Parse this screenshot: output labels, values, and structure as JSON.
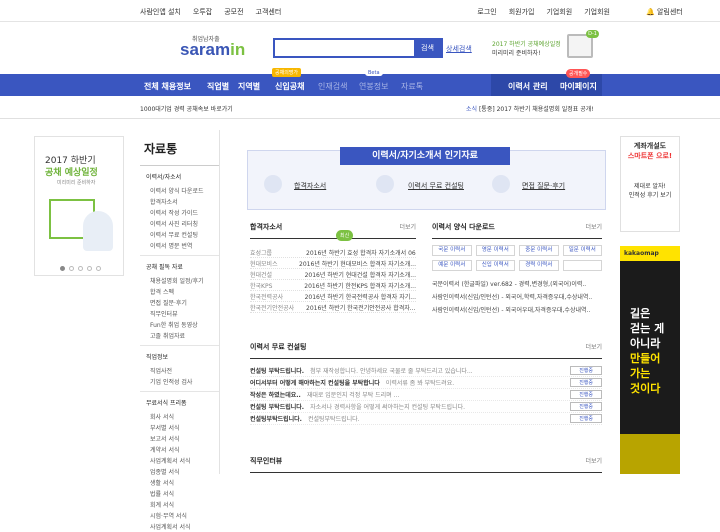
{
  "topbar": {
    "left": [
      "사람인앱 설치",
      "오투잡",
      "공모전",
      "고객센터"
    ],
    "right": [
      "로그인",
      "회원가입",
      "기업회원",
      "기업회원"
    ],
    "bell": "알림센터"
  },
  "logo": {
    "sub": "취업남자출",
    "main": "saram",
    "accent": "in"
  },
  "search": {
    "placeholder": "",
    "button": "검색",
    "detail": "상세검색"
  },
  "promo": {
    "line1": "2017 하반기 공채예상일정",
    "line2": "미리미리 준비하자!",
    "badge": "D-1"
  },
  "gnb": {
    "items": [
      "전체 채용정보",
      "직업별",
      "지역별",
      "신입공채",
      "인재검색",
      "연봉정보",
      "자료톡"
    ],
    "right": [
      "이력서 관리",
      "마이페이지"
    ],
    "tag_new": "공채의명가",
    "tag_beta": "Beta",
    "tag_event": "공개필수"
  },
  "ticker": {
    "left": "1000대기업 경력 공채속보 바로가기",
    "right_label": "소식",
    "right_text": "[통중] 2017 하반기 채용설명회 일정표 공개!"
  },
  "left_banner": {
    "t1": "2017 하반기",
    "t2": "공채 예상일정",
    "t3": "미리미리 준비하자"
  },
  "sidebar": {
    "title": "자료통",
    "sections": [
      {
        "label": "이력서/자소서",
        "items": [
          "이력서 양식 다운로드",
          "합격자소서",
          "이력서 작성 가이드",
          "이력서 사진 리터칭",
          "이력서 무료 컨설팅",
          "이력서 명문 번역"
        ]
      },
      {
        "label": "공채 필독 자료",
        "items": [
          "채용설명회 일정/후기",
          "합격 스펙",
          "면접 질문·후기",
          "직무인터뷰",
          "Fun한 취업 동영상",
          "고졸 취업자료"
        ]
      },
      {
        "label": "직업정보",
        "items": [
          "직업사전",
          "기업 인적성 검사"
        ]
      },
      {
        "label": "무료서식 프리폼",
        "items": [
          "회사 서식",
          "부서별 서식",
          "보고서 서식",
          "계약서 서식",
          "사업계획서 서식",
          "업종별 서식",
          "생활 서식",
          "법률 서식",
          "회계 서식",
          "시험·무역 서식",
          "사업계획서 서식"
        ]
      }
    ]
  },
  "mid": {
    "title": "이력서/자기소개서 인기자료",
    "links": [
      "합격자소서",
      "이력서 무료 컨설팅",
      "면접 질문·후기"
    ]
  },
  "pass": {
    "title": "합격자소서",
    "more": "더보기",
    "ribbon": "최신",
    "rows": [
      [
        "효성그룹",
        "2016년 하반기 효성 합격자 자기소개서 06"
      ],
      [
        "현대모비스",
        "2016년 하반기 현대모비스 합격자 자기소개..."
      ],
      [
        "현대건설",
        "2016년 하반기 현대건설 합격자 자기소개..."
      ],
      [
        "한국KPS",
        "2016년 하반기 한전KPS 합격자 자기소개..."
      ],
      [
        "한국전력공사",
        "2016년 하반기 한국전력공사 합격자 자기..."
      ],
      [
        "한국전기안전공사",
        "2016년 하반기 한국전기안전공사 합격자..."
      ]
    ]
  },
  "resume_dl": {
    "title": "이력서 양식 다운로드",
    "more": "더보기",
    "grid": [
      "국문 이력서",
      "영문 이력서",
      "중문 이력서",
      "일문 이력서",
      "예문 이력서",
      "신입 이력서",
      "경력 이력서",
      ""
    ],
    "lines": [
      "국문이력서 (한글파일) ver.682 - 경력,변경형,(외국어)이력..",
      "사람인이력서(신입/인턴선) - 외국어,학력,자격증우대,수상내역..",
      "사람인이력서(신입/인턴선) - 외국어우대,자격증우대,수상내역.."
    ]
  },
  "consult": {
    "title": "이력서 무료 컨설팅",
    "more": "더보기",
    "btn": "진행중",
    "rows": [
      [
        "컨설팅 부탁드립니다.",
        "첨부 재작성합니다. 안녕하세요 국물로 줄 부탁드리고 있습니다..."
      ],
      [
        "어디서부터 어떻게 해야하는지 컨설팅을 부탁합니다",
        "이력서류 좀 봐 부탁드려요."
      ],
      [
        "작성은 하였는데요..",
        "재대로 입문인지 걱정 부탁 드리며 ..."
      ],
      [
        "컨설팅 부탁드립니다.",
        "자소서나 경력사항을 어떻게 써야하는지 컨설팅 부탁드립니다."
      ],
      [
        "컨설팅부탁드립니다.",
        "컨설팅부탁드립니다."
      ]
    ]
  },
  "interview": {
    "title": "직무인터뷰",
    "more": "더보기"
  },
  "right_banner1": {
    "a": "계좌개설도",
    "b": "스마트폰 으로!",
    "c": "제대로 알자!",
    "d": "인적성 후기 보기"
  },
  "right_banner2": {
    "hdr": "kakaomap",
    "l1": "길은",
    "l2": "걷는 게",
    "l3": "아니라",
    "l4": "만들어",
    "l5": "가는",
    "l6": "것이다"
  }
}
